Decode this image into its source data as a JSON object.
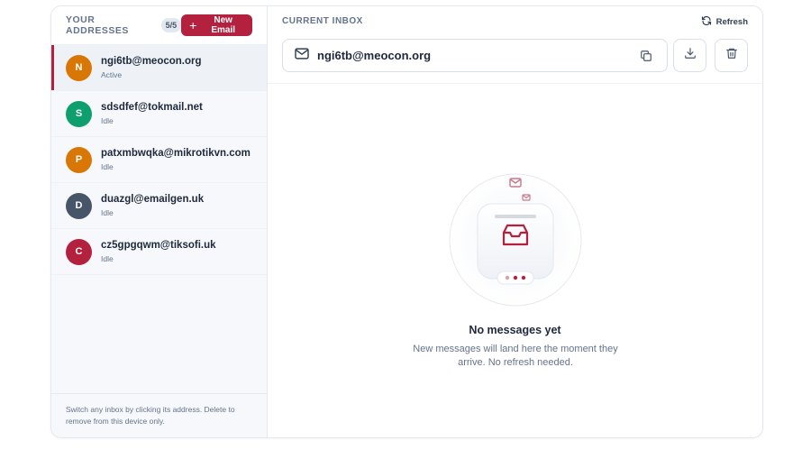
{
  "sidebar": {
    "title": "YOUR ADDRESSES",
    "count": "5/5",
    "new_button": "New Email",
    "items": [
      {
        "initial": "N",
        "email": "ngi6tb@meocon.org",
        "status": "Active",
        "color": "#d97706"
      },
      {
        "initial": "S",
        "email": "sdsdfef@tokmail.net",
        "status": "Idle",
        "color": "#0e9f6e"
      },
      {
        "initial": "P",
        "email": "patxmbwqka@mikrotikvn.com",
        "status": "Idle",
        "color": "#d97706"
      },
      {
        "initial": "D",
        "email": "duazgl@emailgen.uk",
        "status": "Idle",
        "color": "#475569"
      },
      {
        "initial": "C",
        "email": "cz5gpgqwm@tiksofi.uk",
        "status": "Idle",
        "color": "#b4213f"
      }
    ],
    "footer": "Switch any inbox by clicking its address. Delete to remove from this device only."
  },
  "main": {
    "label": "CURRENT INBOX",
    "refresh": "Refresh",
    "email": "ngi6tb@meocon.org",
    "empty_title": "No messages yet",
    "empty_desc": "New messages will land here the moment they arrive. No refresh needed."
  },
  "colors": {
    "accent": "#b4213f",
    "muted": "#64748b"
  }
}
